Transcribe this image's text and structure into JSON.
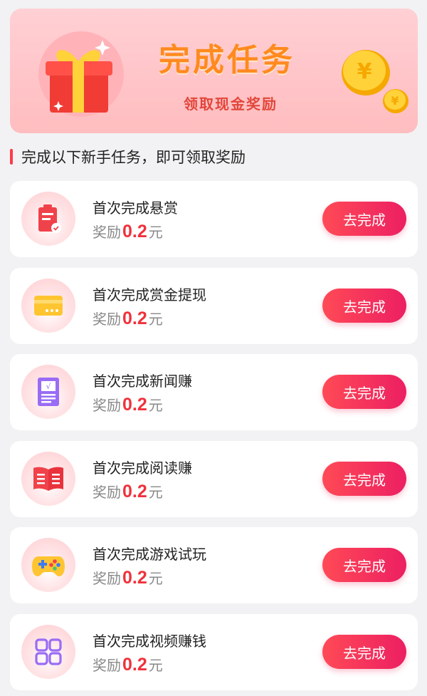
{
  "banner": {
    "title": "完成任务",
    "subtitle": "领取现金奖励",
    "gift_icon": "gift-box-icon",
    "coins_icon": "yuan-coins-icon"
  },
  "section": {
    "title": "完成以下新手任务，即可领取奖励"
  },
  "tasks": [
    {
      "title": "首次完成悬赏",
      "reward_prefix": "奖励",
      "reward_amount": "0.2",
      "reward_unit": "元",
      "button": "去完成",
      "icon": "clipboard-icon"
    },
    {
      "title": "首次完成赏金提现",
      "reward_prefix": "奖励",
      "reward_amount": "0.2",
      "reward_unit": "元",
      "button": "去完成",
      "icon": "card-icon"
    },
    {
      "title": "首次完成新闻赚",
      "reward_prefix": "奖励",
      "reward_amount": "0.2",
      "reward_unit": "元",
      "button": "去完成",
      "icon": "news-document-icon"
    },
    {
      "title": "首次完成阅读赚",
      "reward_prefix": "奖励",
      "reward_amount": "0.2",
      "reward_unit": "元",
      "button": "去完成",
      "icon": "book-icon"
    },
    {
      "title": "首次完成游戏试玩",
      "reward_prefix": "奖励",
      "reward_amount": "0.2",
      "reward_unit": "元",
      "button": "去完成",
      "icon": "gamepad-icon"
    },
    {
      "title": "首次完成视频赚钱",
      "reward_prefix": "奖励",
      "reward_amount": "0.2",
      "reward_unit": "元",
      "button": "去完成",
      "icon": "apps-grid-icon"
    }
  ],
  "colors": {
    "accent": "#f0323c",
    "button_start": "#ff4a56",
    "button_end": "#ec1f62",
    "banner_title": "#ff8a1e"
  }
}
